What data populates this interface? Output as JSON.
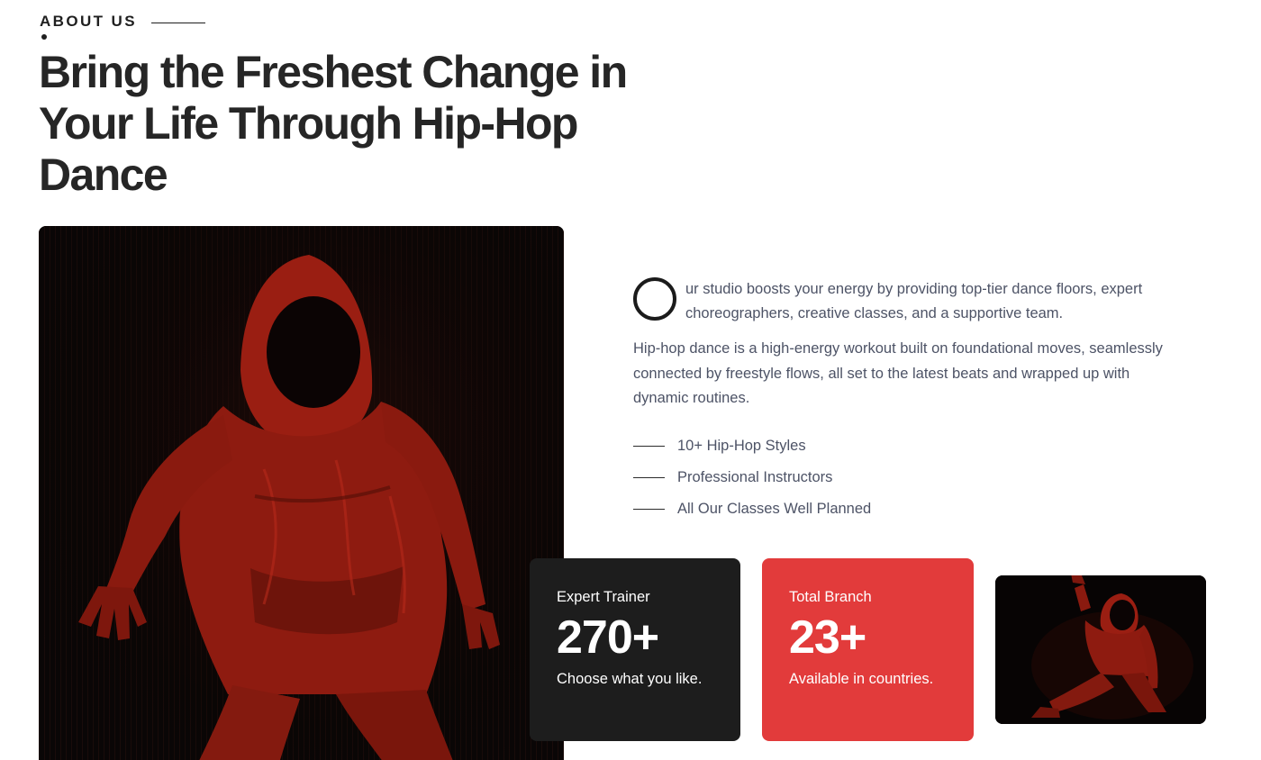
{
  "section": {
    "eyebrow": "ABOUT US"
  },
  "headline": "Bring the Freshest Change in Your Life Through Hip-Hop Dance",
  "intro": {
    "drop_cap": "O",
    "text": "ur studio boosts your energy by providing top-tier dance floors, expert choreographers, creative classes, and a supportive team."
  },
  "description": "Hip-hop dance is a high-energy workout built on foundational moves, seamlessly connected by freestyle flows, all set to the latest beats and wrapped up with dynamic routines.",
  "features": [
    "10+ Hip-Hop Styles",
    "Professional Instructors",
    "All Our Classes Well Planned"
  ],
  "stats": [
    {
      "label": "Expert Trainer",
      "value": "270+",
      "desc": "Choose what you like."
    },
    {
      "label": "Total Branch",
      "value": "23+",
      "desc": "Available in countries."
    }
  ],
  "colors": {
    "accent_red": "#e23b3b",
    "dark_card": "#1d1d1d",
    "heading": "#262626",
    "body_text": "#4d5366"
  }
}
